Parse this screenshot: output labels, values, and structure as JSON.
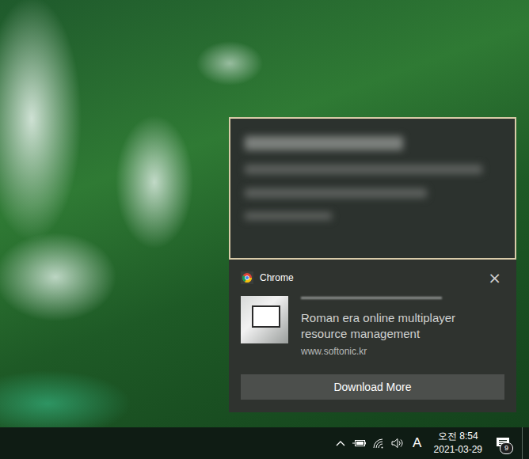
{
  "notification": {
    "app": "Chrome",
    "close": "×",
    "body": "Roman era online multiplayer resource management",
    "source": "www.softonic.kr",
    "button": "Download More"
  },
  "taskbar": {
    "input_indicator": "A",
    "time": "오전 8:54",
    "date": "2021-03-29",
    "notification_count": "9"
  }
}
